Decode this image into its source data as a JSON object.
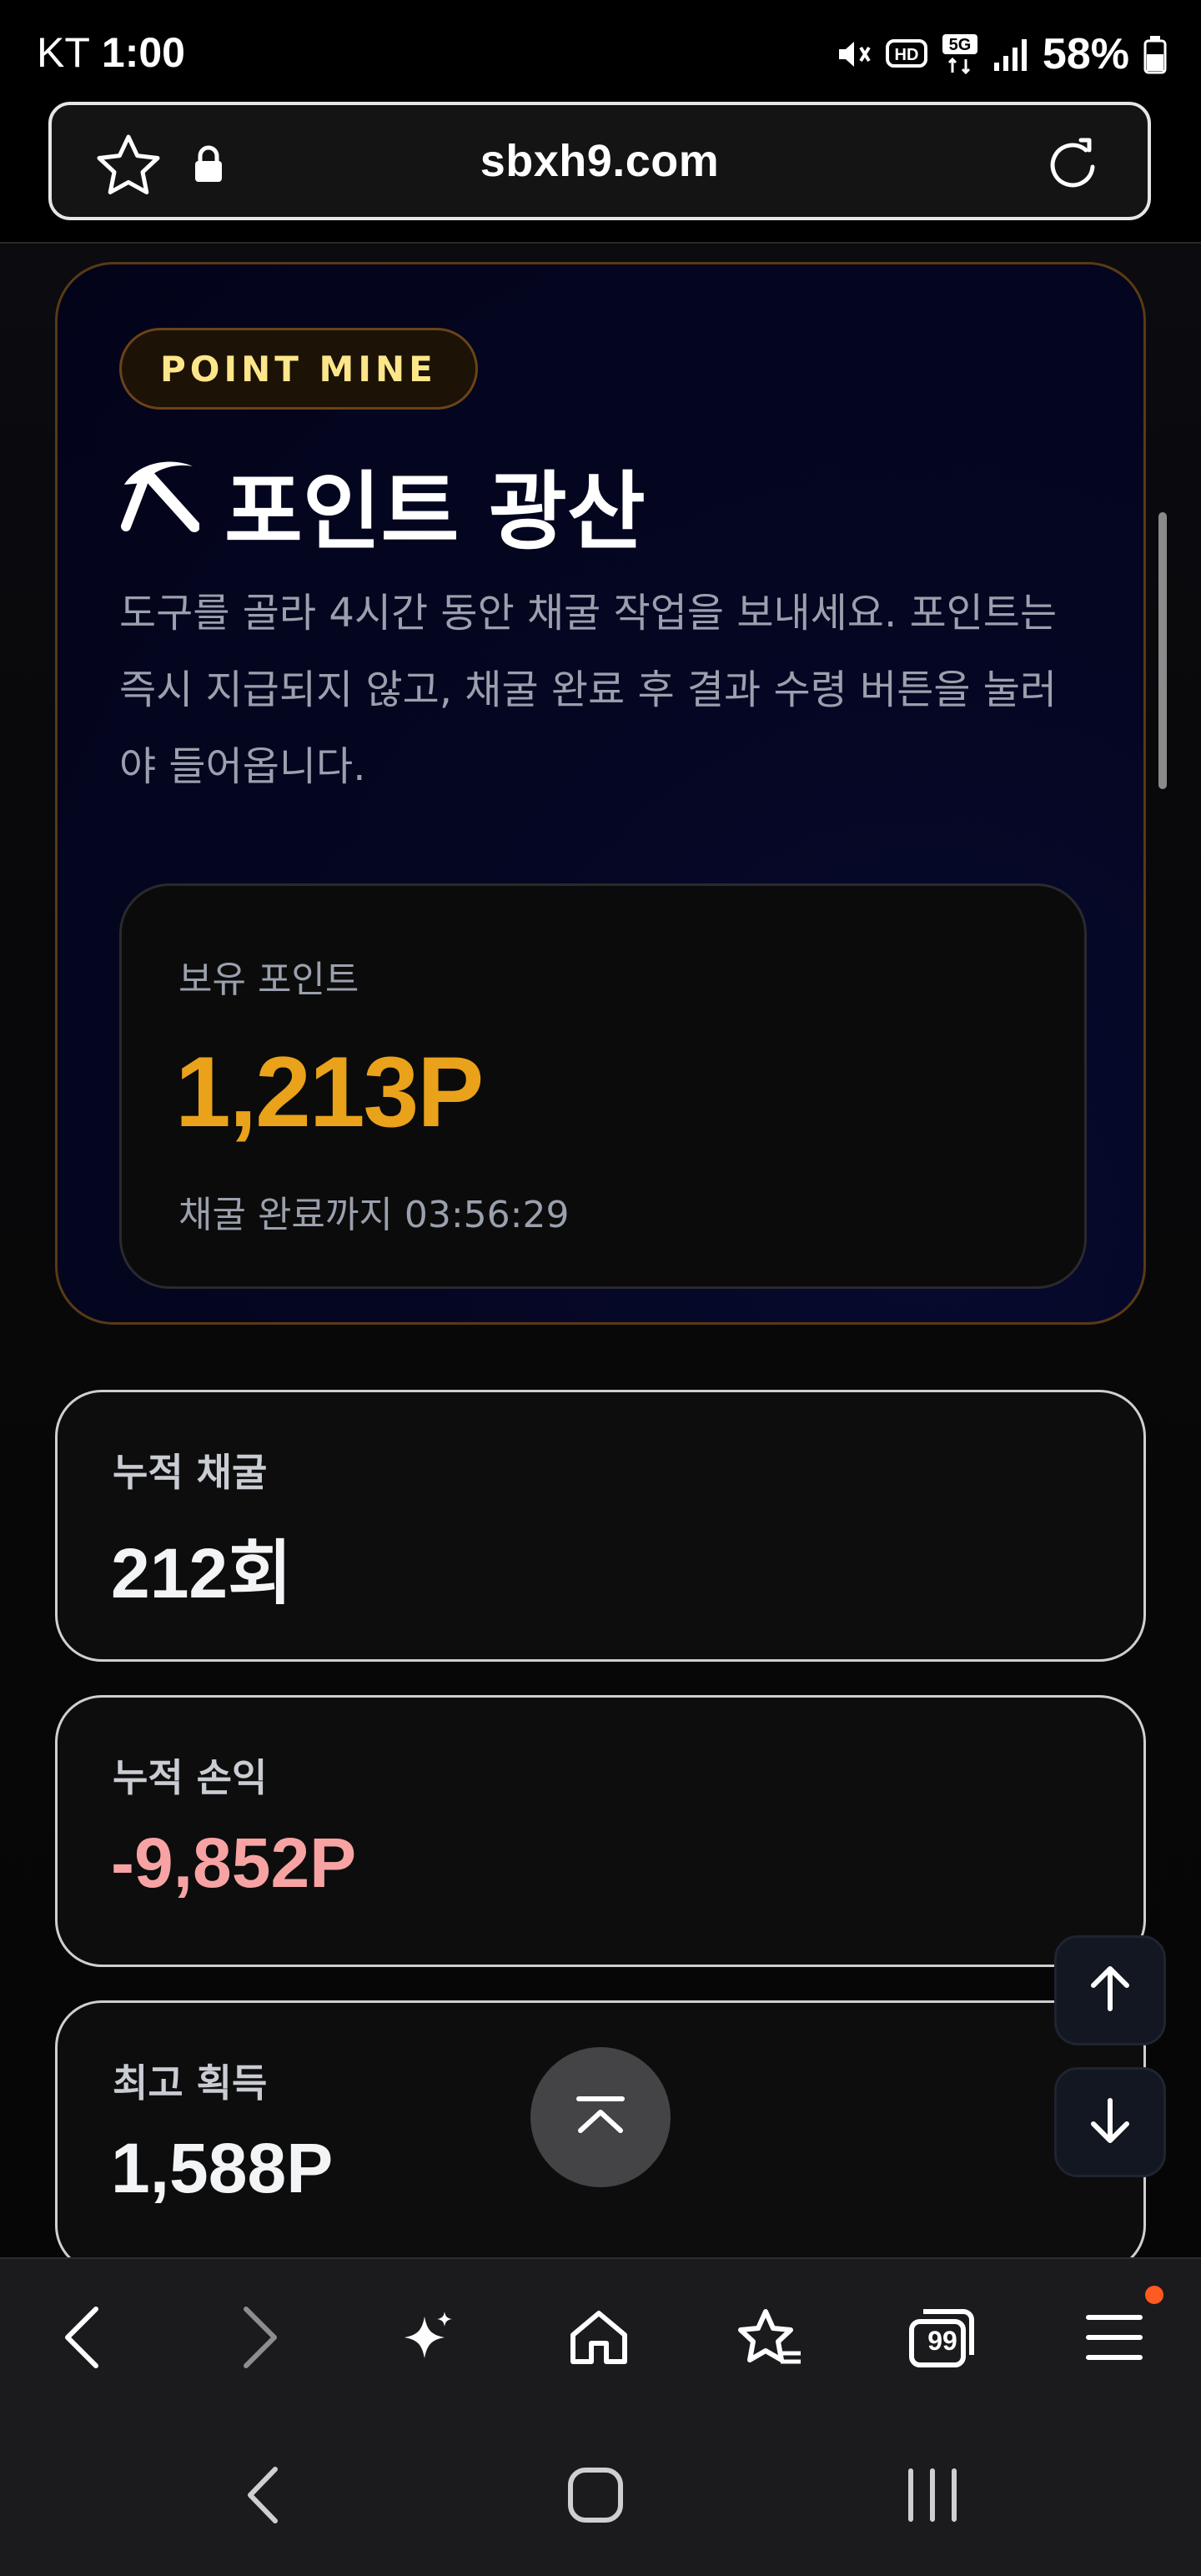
{
  "status_bar": {
    "carrier": "KT",
    "time": "1:00",
    "battery": "58%",
    "icons": [
      "mute-icon",
      "hd-voice-icon",
      "5g-icon",
      "signal-icon",
      "battery-icon"
    ]
  },
  "browser": {
    "url": "sbxh9.com",
    "icons": [
      "bookmark-star-icon",
      "lock-icon",
      "reload-icon"
    ]
  },
  "hero": {
    "badge": "POINT MINE",
    "title_icon": "pickaxe-icon",
    "title": "포인트 광산",
    "description": "도구를 골라 4시간 동안 채굴 작업을 보내세요. 포인트는 즉시 지급되지 않고, 채굴 완료 후 결과 수령 버튼을 눌러야 들어옵니다.",
    "balance": {
      "label": "보유 포인트",
      "value": "1,213P",
      "timer": "채굴 완료까지 03:56:29"
    }
  },
  "stats": [
    {
      "label": "누적 채굴",
      "value": "212회"
    },
    {
      "label": "누적 손익",
      "value": "-9,852P"
    },
    {
      "label": "최고 획득",
      "value": "1,588P"
    }
  ],
  "floating": {
    "scroll_top_icon": "chevron-up-to-top-icon",
    "page_up_icon": "arrow-up-icon",
    "page_down_icon": "arrow-down-icon"
  },
  "bottom_nav": {
    "items": [
      "back-icon",
      "forward-icon",
      "sparkle-ai-icon",
      "home-icon",
      "bookmarks-icon",
      "tabs-icon",
      "menu-icon"
    ],
    "tabs_count": "99",
    "notify_color": "#ff5a1f"
  },
  "system_nav": {
    "items": [
      "system-back-icon",
      "system-home-icon",
      "system-recents-icon"
    ]
  },
  "colors": {
    "accent_gold": "#eaa21a",
    "badge_text": "#fde68a",
    "negative": "#f8a3a3"
  }
}
